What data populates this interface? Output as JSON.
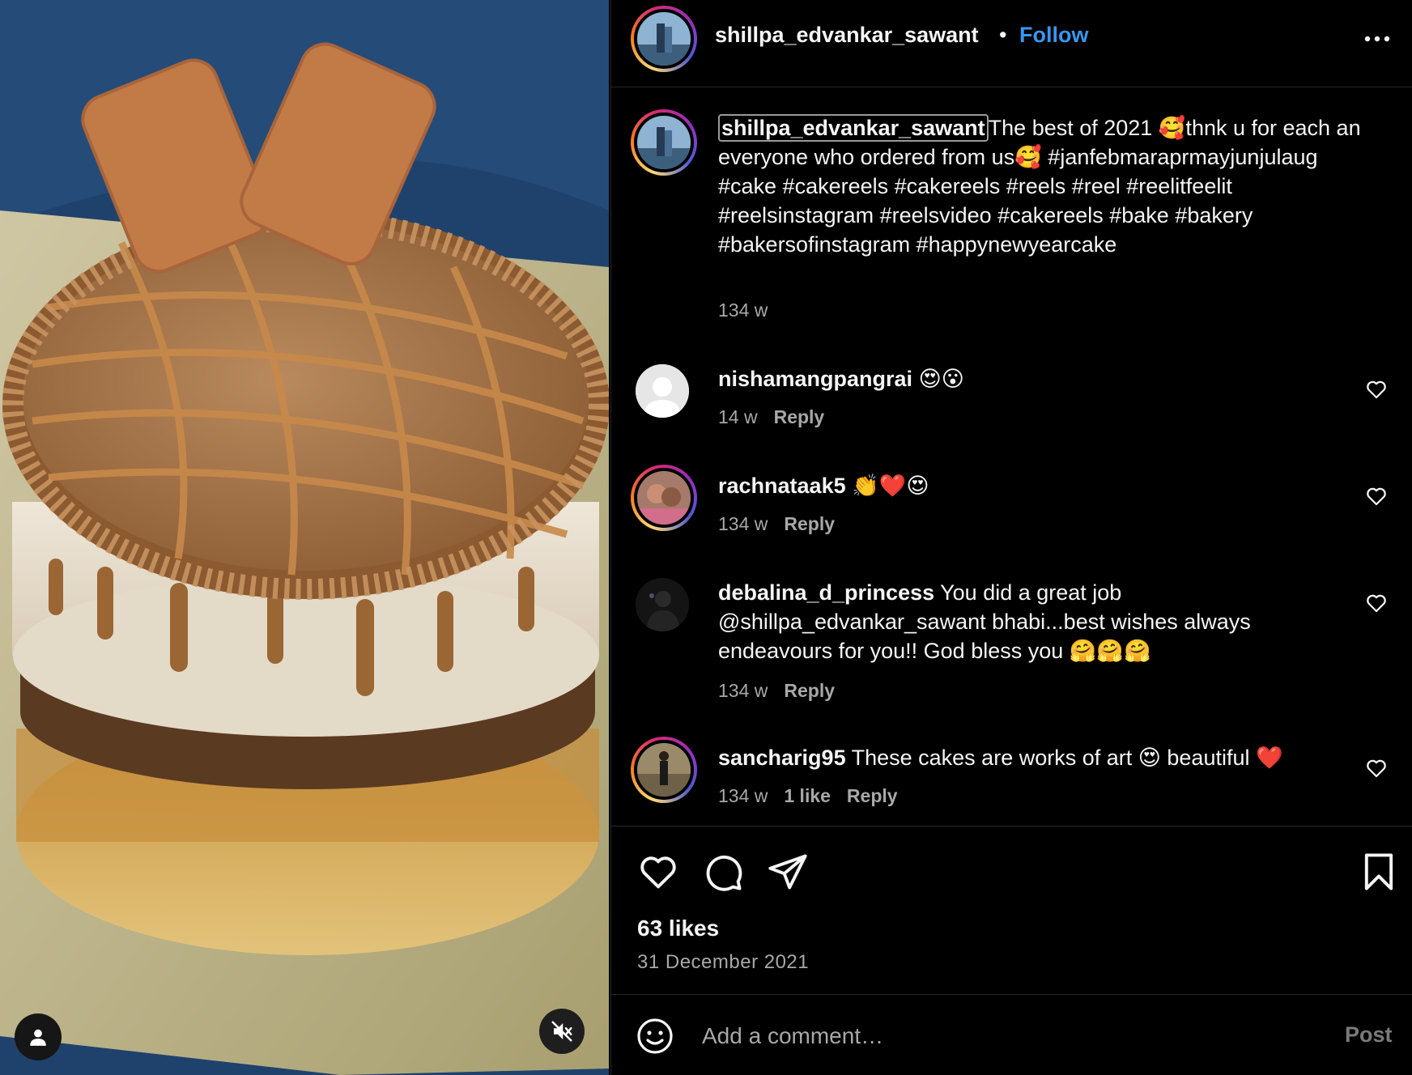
{
  "media": {
    "image": "cake-photo",
    "user_tag_icon": "person-icon",
    "mute_icon": "speaker-muted-icon"
  },
  "header": {
    "username": "shillpa_edvankar_sawant",
    "separator": "•",
    "follow_label": "Follow",
    "more_icon": "more-horizontal-icon"
  },
  "caption": {
    "username": "shillpa_edvankar_sawant",
    "text": "The best of 2021 🥰thnk u for each an everyone who ordered from us🥰 #janfebmaraprmayjunjulaug #cake #cakereels #cakereels #reels #reel #reelitfeelit #reelsinstagram #reelsvideo #cakereels #bake #bakery #bakersofinstagram #happynewyearcake",
    "time": "134 w"
  },
  "comments": [
    {
      "username": "nishamangpangrai",
      "text": "😍😮",
      "time": "14 w",
      "likes": "",
      "reply_label": "Reply"
    },
    {
      "username": "rachnataak5",
      "text": "👏❤️😍",
      "time": "134 w",
      "likes": "",
      "reply_label": "Reply"
    },
    {
      "username": "debalina_d_princess",
      "text": "You did a great job @shillpa_edvankar_sawant bhabi...best wishes always endeavours for you!! God bless you 🤗🤗🤗",
      "time": "134 w",
      "likes": "",
      "reply_label": "Reply"
    },
    {
      "username": "sancharig95",
      "text": "These cakes are works of art 😍 beautiful ❤️",
      "time": "134 w",
      "likes": "1 like",
      "reply_label": "Reply"
    }
  ],
  "actions": {
    "like_icon": "heart-icon",
    "comment_icon": "comment-bubble-icon",
    "share_icon": "paper-plane-icon",
    "save_icon": "bookmark-icon"
  },
  "stats": {
    "likes": "63 likes",
    "date": "31 December 2021"
  },
  "comment_bar": {
    "emoji_icon": "smiley-icon",
    "placeholder": "Add a comment…",
    "post_label": "Post"
  },
  "colors": {
    "background": "#000000",
    "accent": "#3897f0",
    "secondary_text": "#a8a8a8",
    "divider": "#262626"
  }
}
